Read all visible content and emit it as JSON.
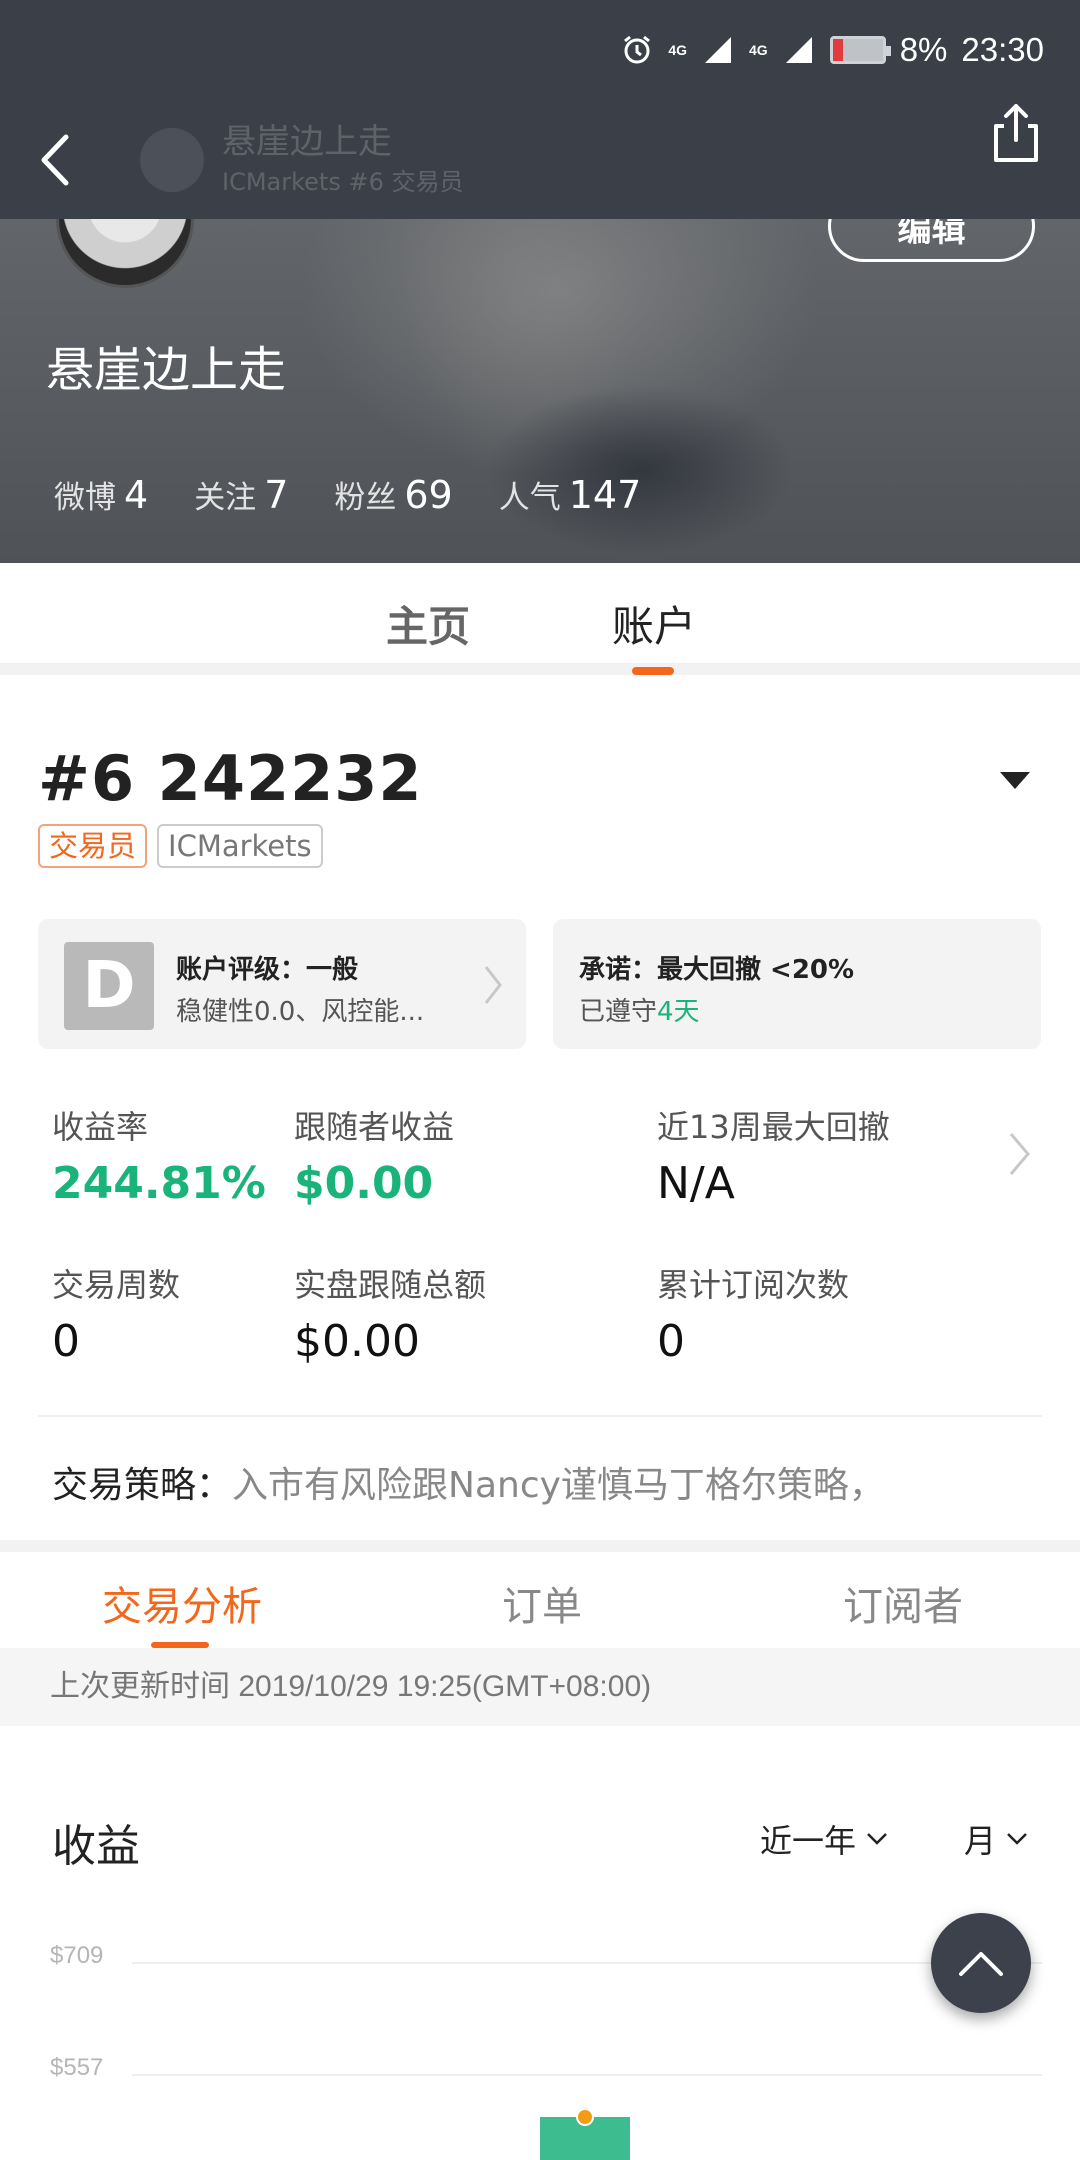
{
  "status_bar": {
    "battery": "8%",
    "time": "23:30",
    "network_1": "4G",
    "network_2": "4G"
  },
  "topbar": {
    "name": "悬崖边上走",
    "subtitle": "ICMarkets #6 交易员"
  },
  "profile": {
    "name": "悬崖边上走",
    "edit_label": "编辑",
    "stats": [
      {
        "label": "微博",
        "value": "4"
      },
      {
        "label": "关注",
        "value": "7"
      },
      {
        "label": "粉丝",
        "value": "69"
      },
      {
        "label": "人气",
        "value": "147"
      }
    ]
  },
  "main_tabs": {
    "home": "主页",
    "account": "账户"
  },
  "account": {
    "number": "#6 242232",
    "tags": {
      "trader": "交易员",
      "broker": "ICMarkets"
    },
    "rating": {
      "badge": "D",
      "title": "账户评级：一般",
      "sub": "稳健性0.0、风控能..."
    },
    "promise": {
      "title": "承诺：最大回撤 <20%",
      "sub_prefix": "已遵守",
      "sub_days": "4天"
    },
    "metrics": {
      "return_label": "收益率",
      "return_value": "244.81%",
      "follower_label": "跟随者收益",
      "follower_value": "$0.00",
      "drawdown_label": "近13周最大回撤",
      "drawdown_value": "N/A",
      "weeks_label": "交易周数",
      "weeks_value": "0",
      "copy_total_label": "实盘跟随总额",
      "copy_total_value": "$0.00",
      "subs_label": "累计订阅次数",
      "subs_value": "0"
    },
    "strategy_label": "交易策略：",
    "strategy_text": "入市有风险跟Nancy谨慎马丁格尔策略，"
  },
  "sub_tabs": {
    "analysis": "交易分析",
    "orders": "订单",
    "subscribers": "订阅者"
  },
  "update_text": "上次更新时间 2019/10/29 19:25(GMT+08:00)",
  "earnings": {
    "title": "收益",
    "period": "近一年",
    "unit": "月"
  },
  "chart_data": {
    "type": "bar",
    "title": "收益",
    "y_ticks": [
      "$709",
      "$557"
    ],
    "bar_color": "#3dbd8f",
    "marker_color": "#f39c12"
  },
  "colors": {
    "accent": "#f4661c",
    "positive": "#1ab37a"
  }
}
